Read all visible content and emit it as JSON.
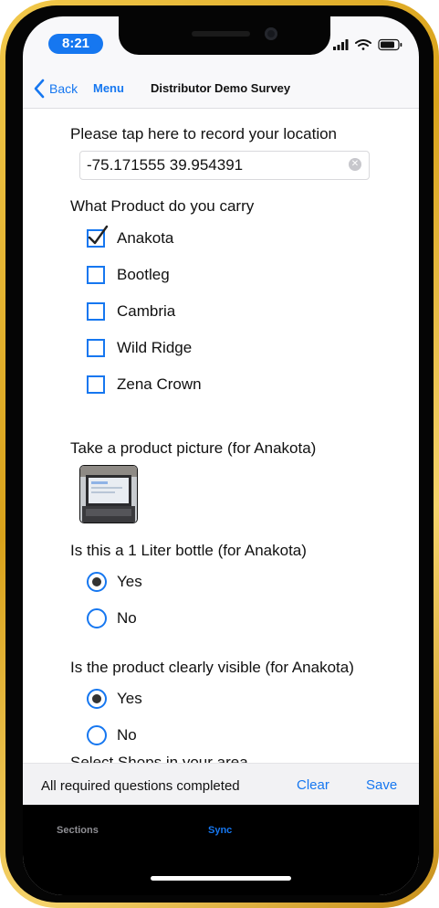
{
  "status_bar": {
    "time": "8:21"
  },
  "nav": {
    "back_label": "Back",
    "menu_label": "Menu",
    "title": "Distributor Demo Survey"
  },
  "survey": {
    "location": {
      "question": "Please tap here to record your location",
      "value": "-75.171555 39.954391"
    },
    "products": {
      "question": "What Product do you carry",
      "options": [
        {
          "label": "Anakota",
          "checked": true
        },
        {
          "label": "Bootleg",
          "checked": false
        },
        {
          "label": "Cambria",
          "checked": false
        },
        {
          "label": "Wild Ridge",
          "checked": false
        },
        {
          "label": "Zena Crown",
          "checked": false
        }
      ]
    },
    "picture": {
      "question": "Take a product picture (for Anakota)"
    },
    "bottle": {
      "question": "Is this a 1 Liter bottle (for Anakota)",
      "options": [
        {
          "label": "Yes",
          "selected": true
        },
        {
          "label": "No",
          "selected": false
        }
      ]
    },
    "visible": {
      "question": "Is the product clearly visible (for Anakota)",
      "options": [
        {
          "label": "Yes",
          "selected": true
        },
        {
          "label": "No",
          "selected": false
        }
      ]
    },
    "next_partial": "Select Shops in your area"
  },
  "footer": {
    "status": "All required questions completed",
    "clear_label": "Clear",
    "save_label": "Save"
  },
  "tabs": [
    {
      "label": "Sections",
      "active": false
    },
    {
      "label": "Sync",
      "active": true
    }
  ],
  "colors": {
    "accent": "#1677f0",
    "frame_gold": "#e0ad2a",
    "tab_inactive": "#8e8e93"
  }
}
